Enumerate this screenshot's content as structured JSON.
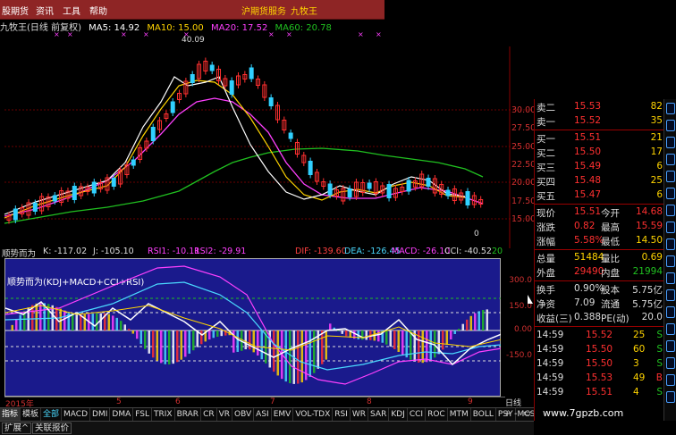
{
  "menu": {
    "items": [
      "股期货",
      "资讯",
      "工具",
      "帮助"
    ],
    "center_labels": [
      "沪期货服务",
      "九牧王"
    ]
  },
  "main_header": {
    "title": "九牧王(日线 前复权)",
    "ma5": "MA5: 14.92",
    "ma10": "MA10: 15.00",
    "ma20": "MA20: 17.52",
    "ma60": "MA60: 20.78",
    "peak_label": "40.09",
    "low_label": "0"
  },
  "price_axis": [
    "30.00",
    "27.50",
    "25.00",
    "22.50",
    "20.00",
    "17.50",
    "15.00"
  ],
  "sub_header": {
    "indicator": "顺势而为",
    "k": "K: -117.02",
    "j": "J: -105.10",
    "rsi1": "RSI1: -10.11",
    "rsi2": "RSI2: -29.91",
    "dif": "DIF: -139.60",
    "dea": "DEA: -126.45",
    "macd": "MACD: -26.10",
    "cci": "CCI: -40.52",
    "trail": "20"
  },
  "indicator_panel": {
    "title": "顺势而为(KDJ+MACD+CCI+RSI)"
  },
  "indicator_axis": [
    "300.0",
    "150.0",
    "0.00",
    "-150.0"
  ],
  "date_row": {
    "year": "2015年",
    "months": [
      "5",
      "6",
      "7",
      "8",
      "9"
    ],
    "period": "日线",
    "plus": "+",
    "minus": "-",
    "expand": "▭"
  },
  "tabs": [
    "指标",
    "模板",
    "全部",
    "MACD",
    "DMI",
    "DMA",
    "FSL",
    "TRIX",
    "BRAR",
    "CR",
    "VR",
    "OBV",
    "ASI",
    "EMV",
    "VOL-TDX",
    "RSI",
    "WR",
    "SAR",
    "KDJ",
    "CCI",
    "ROC",
    "MTM",
    "BOLL",
    "PSY",
    "MCST"
  ],
  "bottom_buttons": [
    "扩展^",
    "关联报价"
  ],
  "order_book": {
    "asks": [
      {
        "label": "卖二",
        "price": "15.53",
        "vol": "82"
      },
      {
        "label": "卖一",
        "price": "15.52",
        "vol": "35"
      }
    ],
    "bids": [
      {
        "label": "买一",
        "price": "15.51",
        "vol": "21"
      },
      {
        "label": "买二",
        "price": "15.50",
        "vol": "17"
      },
      {
        "label": "买三",
        "price": "15.49",
        "vol": "6"
      },
      {
        "label": "买四",
        "price": "15.48",
        "vol": "25"
      },
      {
        "label": "买五",
        "price": "15.47",
        "vol": "6"
      }
    ]
  },
  "quote": [
    {
      "l1": "现价",
      "v1": "15.51",
      "l2": "今开",
      "v2": "14.68"
    },
    {
      "l1": "涨跌",
      "v1": "0.82",
      "l2": "最高",
      "v2": "15.59"
    },
    {
      "l1": "涨幅",
      "v1": "5.58%",
      "l2": "最低",
      "v2": "14.50"
    },
    {
      "l1": "总量",
      "v1": "51484",
      "l2": "量比",
      "v2": "0.69"
    },
    {
      "l1": "外盘",
      "v1": "29490",
      "l2": "内盘",
      "v2": "21994"
    },
    {
      "l1": "换手",
      "v1": "0.90%",
      "l2": "股本",
      "v2": "5.75亿"
    },
    {
      "l1": "净资",
      "v1": "7.09",
      "l2": "流通",
      "v2": "5.75亿"
    },
    {
      "l1": "收益(三)",
      "v1": "0.388",
      "l2": "PE(动)",
      "v2": "20.0"
    }
  ],
  "trades": [
    {
      "time": "14:59",
      "price": "15.52",
      "vol": "25",
      "side": "S"
    },
    {
      "time": "14:59",
      "price": "15.50",
      "vol": "60",
      "side": "S"
    },
    {
      "time": "14:59",
      "price": "15.50",
      "vol": "3",
      "side": "S"
    },
    {
      "time": "14:59",
      "price": "15.53",
      "vol": "49",
      "side": "B"
    },
    {
      "time": "14:59",
      "price": "15.51",
      "vol": "4",
      "side": "S"
    }
  ],
  "watermark": "www.7gpzb.com",
  "colors": {
    "up": "#ff3030",
    "down": "#30d0ff",
    "ma5": "#ffffff",
    "ma10": "#ffd400",
    "ma20": "#ff40ff",
    "ma60": "#20c020"
  }
}
